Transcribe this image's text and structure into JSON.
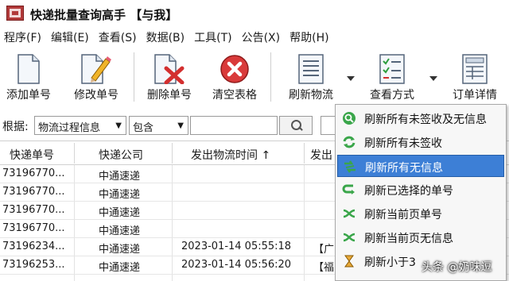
{
  "window": {
    "title": "快递批量查询高手 【与我】"
  },
  "menu": [
    "程序(F)",
    "编辑(E)",
    "查看(S)",
    "数据(B)",
    "工具(T)",
    "公告(X)",
    "帮助(H)"
  ],
  "toolbar": {
    "add": "添加单号",
    "edit": "修改单号",
    "delete": "删除单号",
    "clear": "清空表格",
    "refresh": "刷新物流",
    "view_mode": "查看方式",
    "detail": "订单详情"
  },
  "filter": {
    "label": "根据:",
    "field": "物流过程信息",
    "operator": "包含",
    "value": ""
  },
  "grid": {
    "headers": [
      "快递单号",
      "快递公司",
      "发出物流时间 ↑",
      "发出"
    ],
    "rows": [
      [
        "73196770...",
        "中通速递",
        "",
        ""
      ],
      [
        "73196770...",
        "中通速递",
        "",
        ""
      ],
      [
        "73196770...",
        "中通速递",
        "",
        ""
      ],
      [
        "73196770...",
        "中通速递",
        "",
        ""
      ],
      [
        "73196234...",
        "中通速递",
        "2023-01-14 05:55:18",
        "【广"
      ],
      [
        "73196253...",
        "中通速递",
        "2023-01-14 05:56:20",
        "【福"
      ]
    ]
  },
  "dropdown": {
    "items": [
      "刷新所有未签收及无信息",
      "刷新所有未签收",
      "刷新所有无信息",
      "刷新已选择的单号",
      "刷新当前页单号",
      "刷新当前页无信息",
      "刷新小于3"
    ],
    "selected_index": 2,
    "selected_color": "#3d7fd6"
  },
  "watermark": "头条 @奶味逗"
}
